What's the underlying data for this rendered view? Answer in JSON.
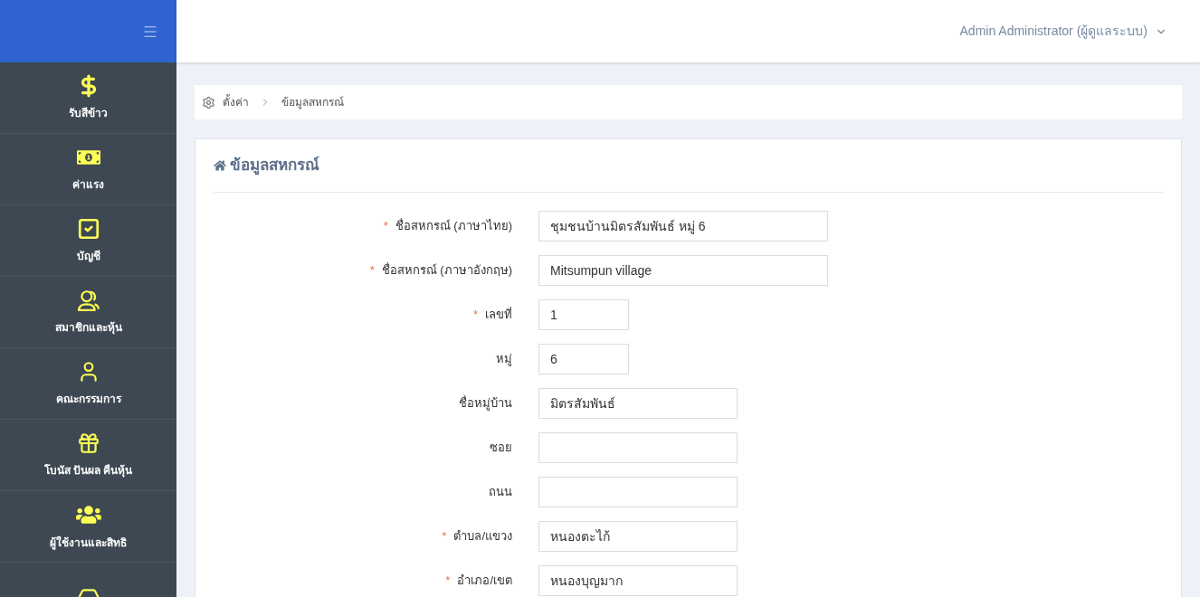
{
  "header": {
    "user": "Admin Administrator (ผู้ดูแลระบบ)"
  },
  "sidebar": {
    "items": [
      {
        "kind": "dollar",
        "label": "รับสีข้าว"
      },
      {
        "kind": "money",
        "label": "ค่าแรง"
      },
      {
        "kind": "check",
        "label": "บัญชี"
      },
      {
        "kind": "group",
        "label": "สมาชิกและหุ้น"
      },
      {
        "kind": "person",
        "label": "คณะกรรมการ"
      },
      {
        "kind": "gift",
        "label": "โบนัส ปันผล คืนหุ้น"
      },
      {
        "kind": "team",
        "label": "ผู้ใช้งานและสิทธิ"
      },
      {
        "kind": "inbox"
      }
    ]
  },
  "breadcrumb": [
    "ตั้งค่า",
    "ข้อมูลสหกรณ์"
  ],
  "card": {
    "title": "ข้อมูลสหกรณ์",
    "fields": [
      {
        "kind": "long",
        "mark": "*",
        "label": "ชื่อสหกรณ์ (ภาษาไทย)",
        "value": "ชุมชนบ้านมิตรสัมพันธ์ หมู่ 6"
      },
      {
        "kind": "long",
        "mark": "*",
        "label": "ชื่อสหกรณ์ (ภาษาอังกฤษ)",
        "value": "Mitsumpun village"
      },
      {
        "kind": "short",
        "mark": "*",
        "label": "เลขที่",
        "value": "1"
      },
      {
        "kind": "short",
        "label": "หมู่",
        "value": "6"
      },
      {
        "kind": "medium",
        "label": "ชื่อหมู่บ้าน",
        "value": "มิตรสัมพันธ์"
      },
      {
        "kind": "medium",
        "label": "ซอย"
      },
      {
        "kind": "medium",
        "label": "ถนน"
      },
      {
        "kind": "medium",
        "mark": "*",
        "label": "ตำบล/แขวง",
        "value": "หนองตะไก้"
      },
      {
        "kind": "medium",
        "mark": "*",
        "label": "อำเภอ/เขต",
        "value": "หนองบุญมาก"
      }
    ]
  }
}
